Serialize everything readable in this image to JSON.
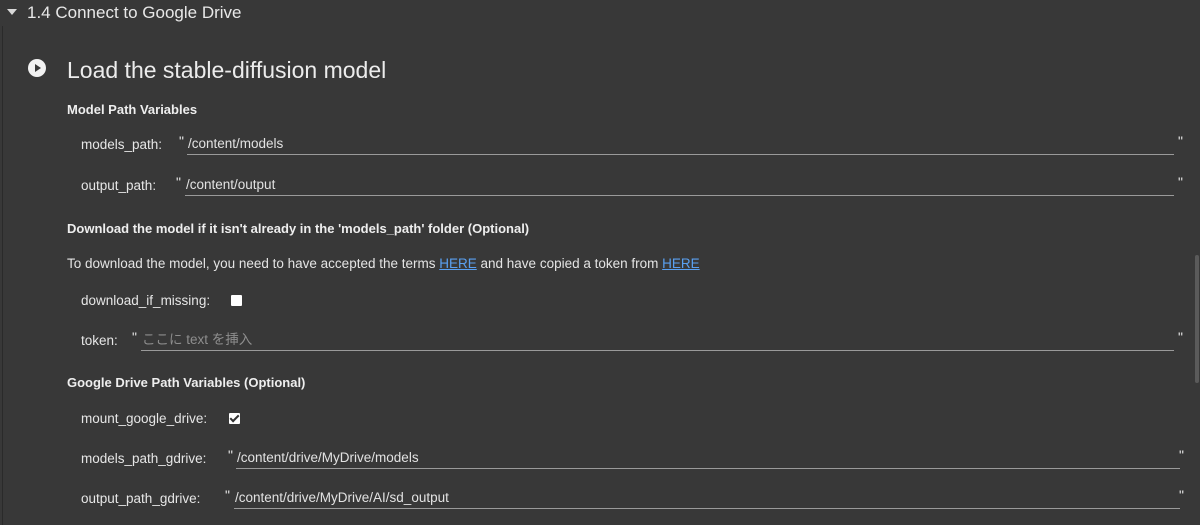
{
  "section": {
    "title": "1.4 Connect to Google Drive"
  },
  "cell": {
    "title": "Load the stable-diffusion model"
  },
  "model_path": {
    "heading": "Model Path Variables",
    "models_path": {
      "label": "models_path:",
      "value": "/content/models"
    },
    "output_path": {
      "label": "output_path:",
      "value": "/content/output"
    }
  },
  "download": {
    "heading": "Download the model if it isn't already in the 'models_path' folder (Optional)",
    "text_before": "To download the model, you need to have accepted the terms ",
    "link1": "HERE",
    "text_middle": " and have copied a token from ",
    "link2": "HERE",
    "download_if_missing": {
      "label": "download_if_missing:",
      "checked": false
    },
    "token": {
      "label": "token:",
      "value": "",
      "placeholder": "ここに text を挿入"
    }
  },
  "gdrive": {
    "heading": "Google Drive Path Variables (Optional)",
    "mount_google_drive": {
      "label": "mount_google_drive:",
      "checked": true
    },
    "models_path_gdrive": {
      "label": "models_path_gdrive:",
      "value": "/content/drive/MyDrive/models"
    },
    "output_path_gdrive": {
      "label": "output_path_gdrive:",
      "value": "/content/drive/MyDrive/AI/sd_output"
    }
  },
  "quote": "\""
}
